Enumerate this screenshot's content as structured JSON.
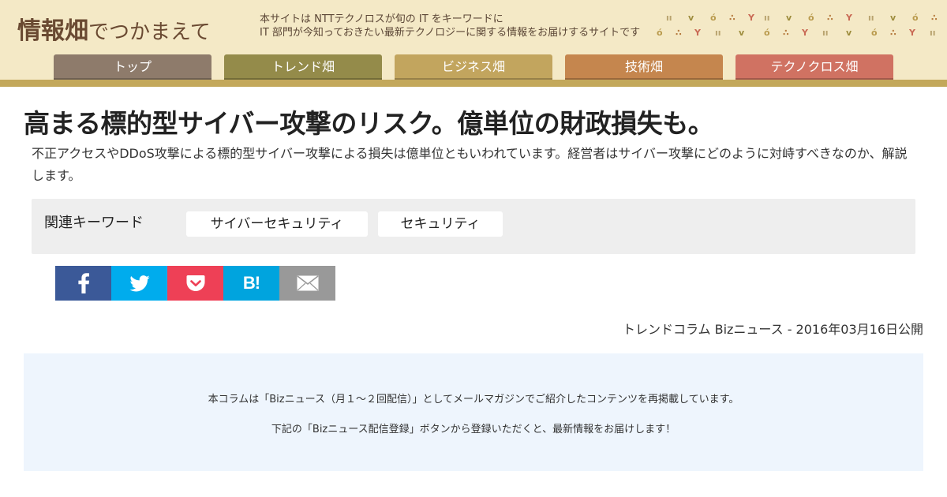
{
  "header": {
    "logo_main": "情報畑",
    "logo_sub": "でつかまえて",
    "tagline_line1": "本サイトは NTTテクノロスが旬の IT をキーワードに",
    "tagline_line2": "IT 部門が今知っておきたい最新テクノロジーに関する情報をお届けするサイトです",
    "pattern_icon": "sprout-pattern-decoration"
  },
  "nav": {
    "tabs": [
      {
        "label": "トップ",
        "color": "#8e7b6b"
      },
      {
        "label": "トレンド畑",
        "color": "#948b4a"
      },
      {
        "label": "ビジネス畑",
        "color": "#c2a55e"
      },
      {
        "label": "技術畑",
        "color": "#c5864e"
      },
      {
        "label": "テクノクロス畑",
        "color": "#d07262"
      }
    ]
  },
  "article": {
    "title": "高まる標的型サイバー攻撃のリスク。億単位の財政損失も。",
    "lead": "不正アクセスやDDoS攻撃による標的型サイバー攻撃による損失は億単位ともいわれています。経営者はサイバー攻撃にどのように対峙すべきなのか、解説します。",
    "keyword_label": "関連キーワード",
    "keywords": [
      "サイバーセキュリティ",
      "セキュリティ"
    ],
    "byline": "トレンドコラム Bizニュース - 2016年03月16日公開"
  },
  "share": {
    "buttons": [
      {
        "name": "facebook",
        "icon": "facebook-icon",
        "color": "#3b5998"
      },
      {
        "name": "twitter",
        "icon": "twitter-icon",
        "color": "#00aced"
      },
      {
        "name": "pocket",
        "icon": "pocket-icon",
        "color": "#ee4056"
      },
      {
        "name": "hatena",
        "icon": "hatena-bookmark-icon",
        "label": "B!",
        "color": "#00a4de"
      },
      {
        "name": "mail",
        "icon": "mail-icon",
        "color": "#999999"
      }
    ]
  },
  "notice": {
    "line1": "本コラムは「Bizニュース（月１～２回配信）」としてメールマガジンでご紹介したコンテンツを再掲載しています。",
    "line2": "下記の「Bizニュース配信登録」ボタンから登録いただくと、最新情報をお届けします！"
  },
  "colors": {
    "header_bg": "#f4e9c6",
    "header_bar": "#c3a85b",
    "logo": "#6a4a32",
    "keyword_box": "#eeeeee",
    "notice_bg": "#eef5fd"
  }
}
